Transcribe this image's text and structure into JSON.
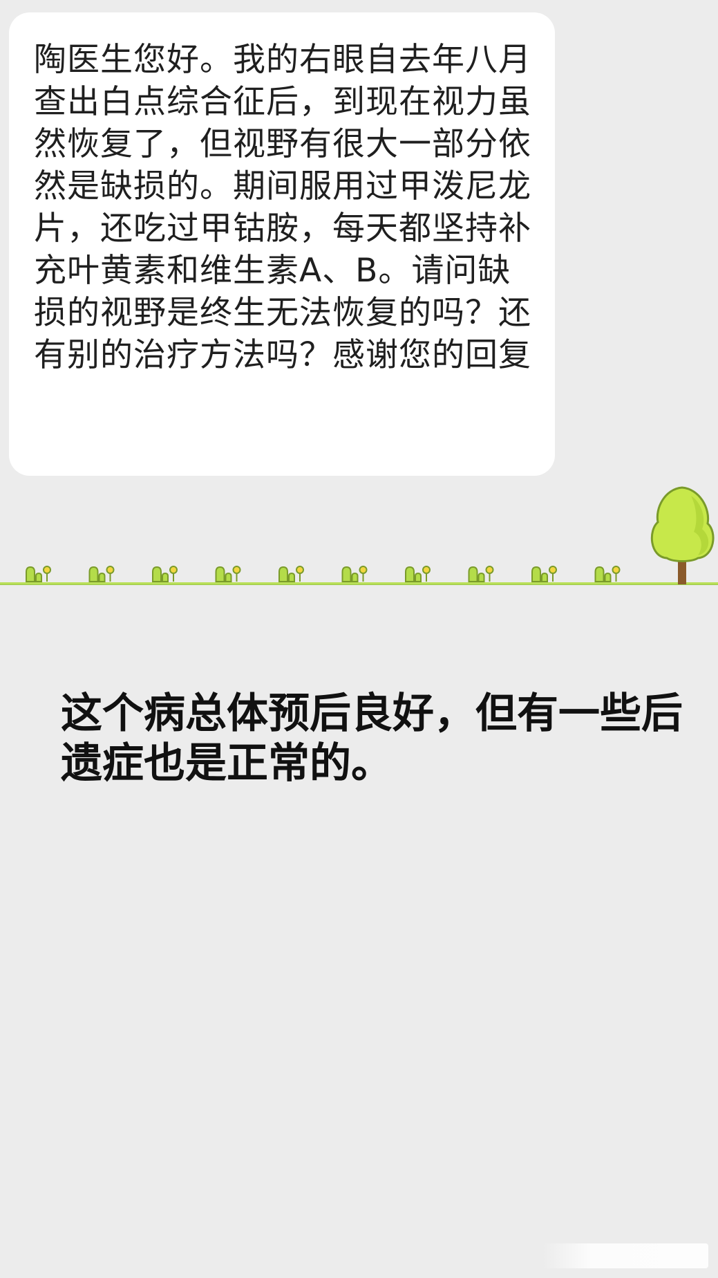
{
  "message": {
    "text": "陶医生您好。我的右眼自去年八月查出白点综合征后，到现在视力虽然恢复了，但视野有很大一部分依然是缺损的。期间服用过甲泼尼龙片，还吃过甲钴胺，每天都坚持补充叶黄素和维生素A、B。请问缺损的视野是终生无法恢复的吗？还有别的治疗方法吗？感谢您的回复"
  },
  "reply": {
    "text": "这个病总体预后良好，但有一些后遗症也是正常的。"
  },
  "colors": {
    "background": "#ececec",
    "bubble": "#ffffff",
    "grass": "#8fd14f",
    "grass_line": "#b9df58",
    "tree_crown": "#c7e84a",
    "tree_outline": "#7a9b2a",
    "trunk": "#8a5a2b"
  },
  "icons": [
    "grass-sprout-icon",
    "tree-icon"
  ]
}
